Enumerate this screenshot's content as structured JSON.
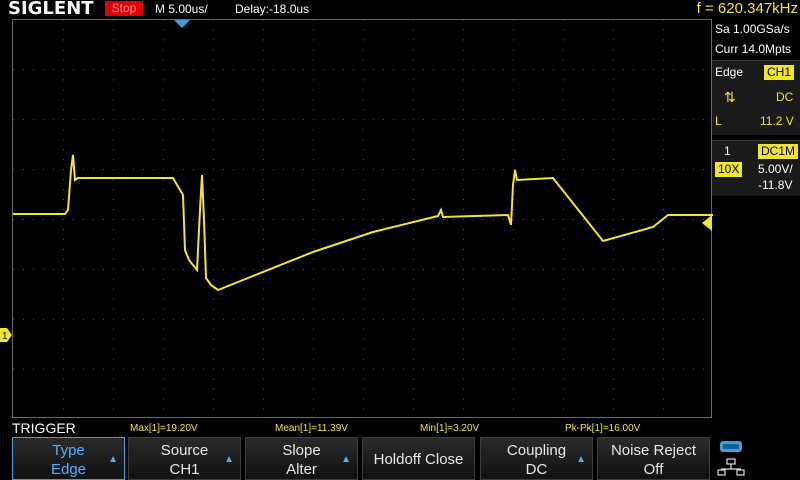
{
  "header": {
    "brand": "SIGLENT",
    "run_state": "Stop",
    "timebase": "M 5.00us/",
    "delay": "Delay:-18.0us",
    "frequency": "f = 620.347kHz"
  },
  "acquisition": {
    "sample_rate": "Sa 1.00GSa/s",
    "memory": "Curr 14.0Mpts"
  },
  "trigger_panel": {
    "type": "Edge",
    "source": "CH1",
    "slope_icon": "rising-falling-edge-icon",
    "coupling": "DC",
    "level_label": "L",
    "level": "11.2 V"
  },
  "channel_panel": {
    "channel_num": "1",
    "coupling": "DC1M",
    "probe": "10X",
    "scale": "5.00V/",
    "offset": "-11.8V"
  },
  "markers": {
    "ch1_ground_label": "1"
  },
  "measurements": {
    "menu_title": "TRIGGER",
    "max": "Max[1]=19.20V",
    "mean": "Mean[1]=11.39V",
    "min": "Min[1]=3.20V",
    "pkpk": "Pk-Pk[1]=16.00V"
  },
  "softkeys": [
    {
      "line1": "Type",
      "line2": "Edge",
      "active": true,
      "arrow": true
    },
    {
      "line1": "Source",
      "line2": "CH1",
      "active": false,
      "arrow": true
    },
    {
      "line1": "Slope",
      "line2": "Alter",
      "active": false,
      "arrow": true
    },
    {
      "line1": "Holdoff Close",
      "line2": "",
      "active": false,
      "arrow": false
    },
    {
      "line1": "Coupling",
      "line2": "DC",
      "active": false,
      "arrow": true
    },
    {
      "line1": "Noise Reject",
      "line2": "Off",
      "active": false,
      "arrow": false
    }
  ],
  "colors": {
    "trace": "#f2e629",
    "run_state_bg": "#e10000",
    "accent": "#3aa0e0"
  }
}
